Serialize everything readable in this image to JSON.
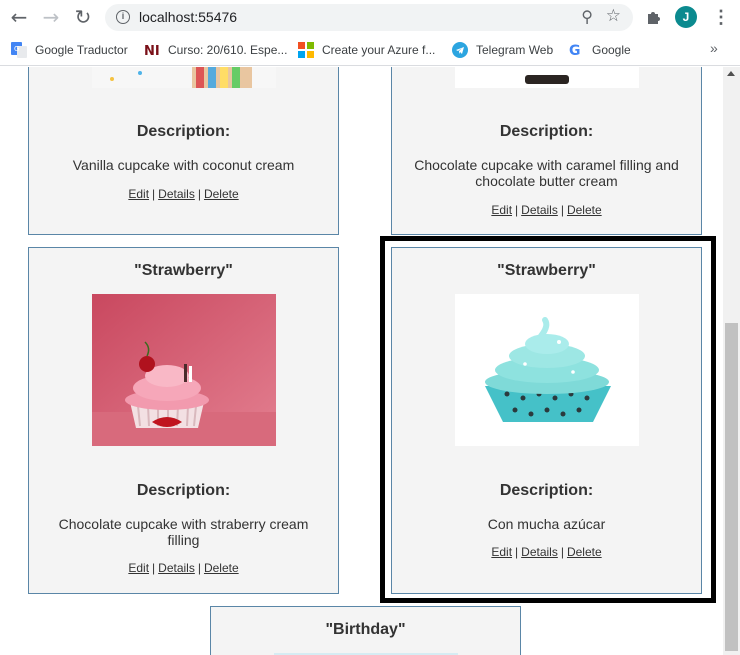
{
  "browser": {
    "url": "localhost:55476",
    "avatar_letter": "J",
    "bookmarks": [
      {
        "label": "Google Traductor",
        "icon": "google-translate-icon"
      },
      {
        "label": "Curso: 20/610. Espe...",
        "icon": "ni-icon"
      },
      {
        "label": "Create your Azure f...",
        "icon": "microsoft-icon"
      },
      {
        "label": "Telegram Web",
        "icon": "telegram-icon"
      },
      {
        "label": "Google",
        "icon": "google-icon"
      }
    ],
    "bookmarks_overflow": "»"
  },
  "cards": [
    {
      "title": "",
      "description_heading": "Description:",
      "description": "Vanilla cupcake with coconut cream",
      "image": "vanilla-cupcake-image"
    },
    {
      "title": "",
      "description_heading": "Description:",
      "description": "Chocolate cupcake with caramel filling and chocolate butter cream",
      "image": "chocolate-cupcake-image"
    },
    {
      "title": "\"Strawberry\"",
      "description_heading": "Description:",
      "description": "Chocolate cupcake with straberry cream filling",
      "image": "strawberry-cupcake-image"
    },
    {
      "title": "\"Strawberry\"",
      "description_heading": "Description:",
      "description": "Con mucha azúcar",
      "image": "teal-cupcake-image"
    },
    {
      "title": "\"Birthday\"",
      "image": "birthday-cupcake-image"
    }
  ],
  "actions": {
    "edit": "Edit",
    "details": "Details",
    "delete": "Delete",
    "separator": "|"
  },
  "colors": {
    "card_border": "#5a86a7",
    "card_bg": "#f4f4f4",
    "highlight": "#000000",
    "avatar": "#0b8a8f"
  }
}
